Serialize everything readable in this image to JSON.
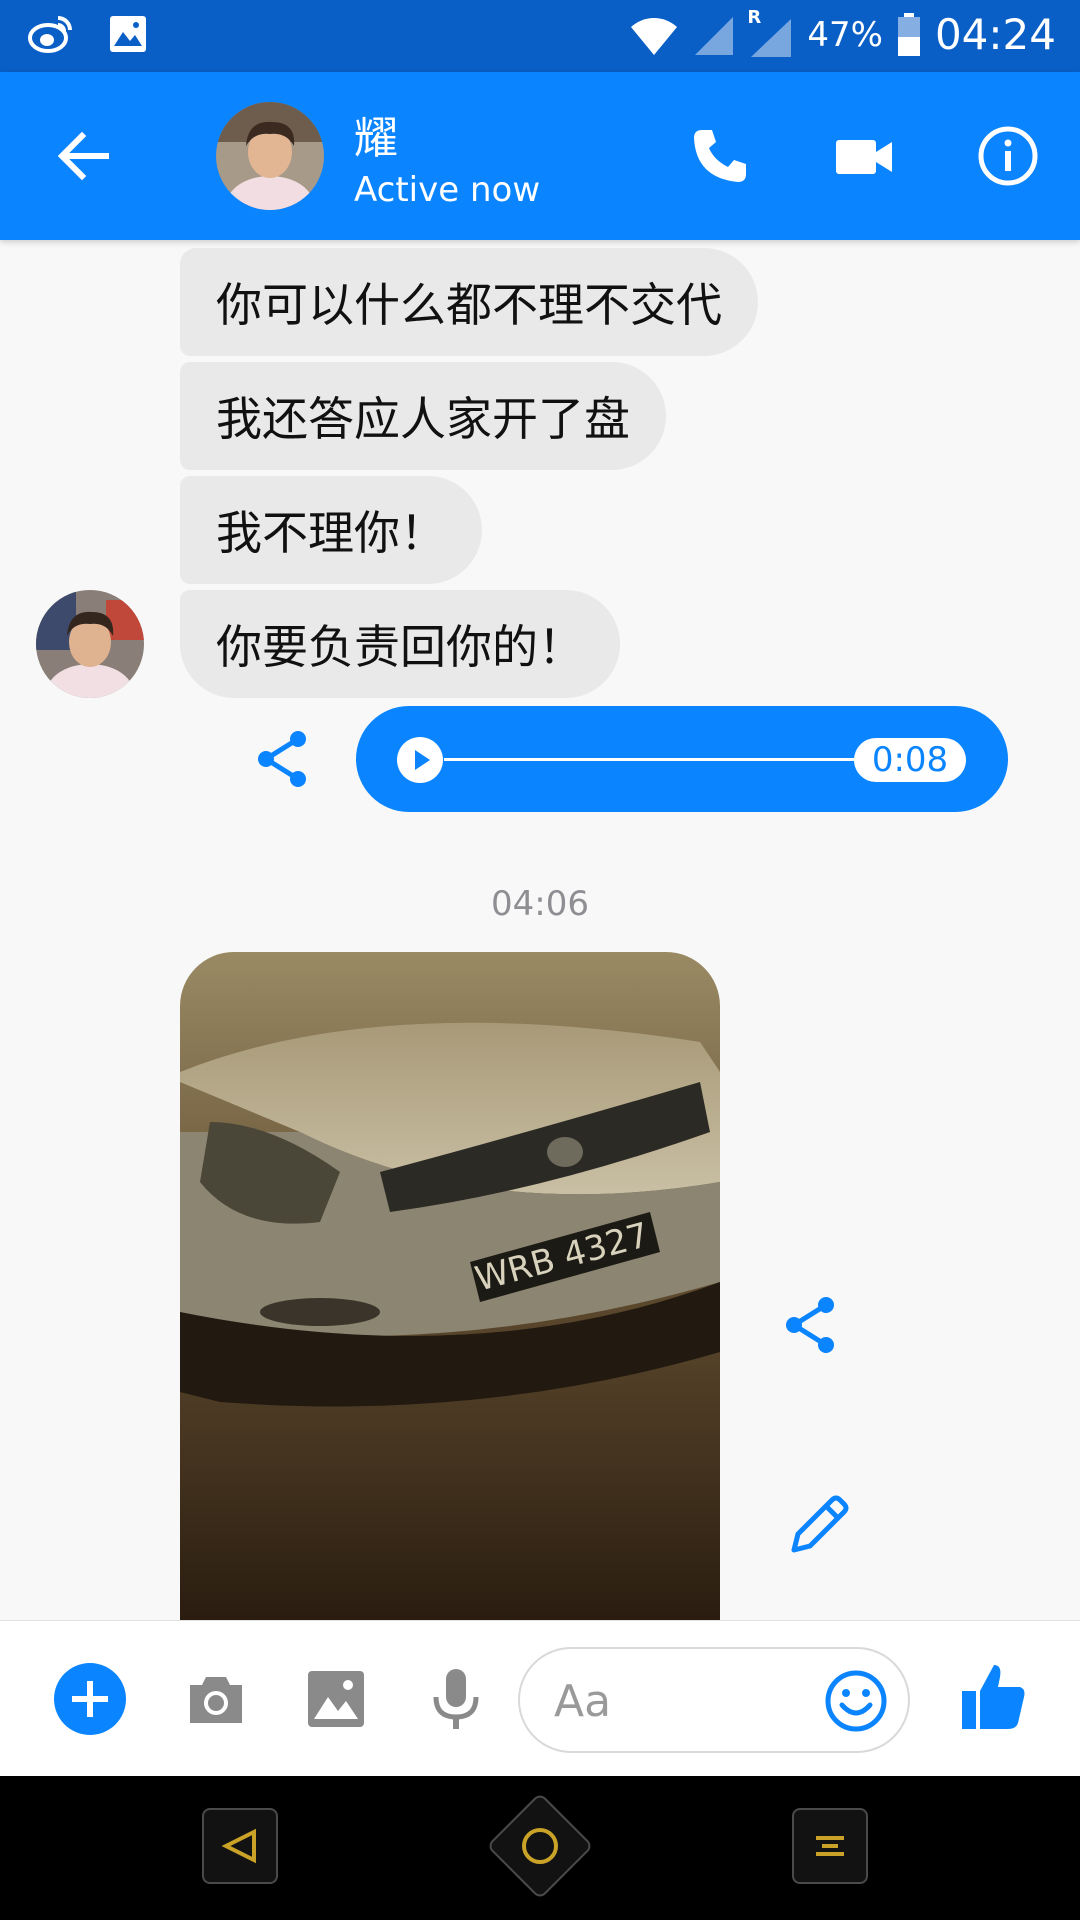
{
  "status_bar": {
    "battery": "47%",
    "time": "04:24",
    "roaming": "R"
  },
  "header": {
    "contact_name": "耀",
    "status": "Active now"
  },
  "messages": [
    {
      "text": "你可以什么都不理不交代"
    },
    {
      "text": "我还答应人家开了盘"
    },
    {
      "text": "我不理你！"
    },
    {
      "text": "你要负责回你的！"
    }
  ],
  "audio_message": {
    "duration": "0:08",
    "progress": 0
  },
  "timestamp": "04:06",
  "photo_message": {
    "plate_text": "WRB 4327"
  },
  "composer": {
    "placeholder": "Aa"
  },
  "colors": {
    "accent": "#0a84ff",
    "status_bar": "#0a5fc7",
    "bubble_incoming": "#e9e9ea",
    "timestamp": "#8e8e93",
    "nav_accent": "#c9a227"
  }
}
